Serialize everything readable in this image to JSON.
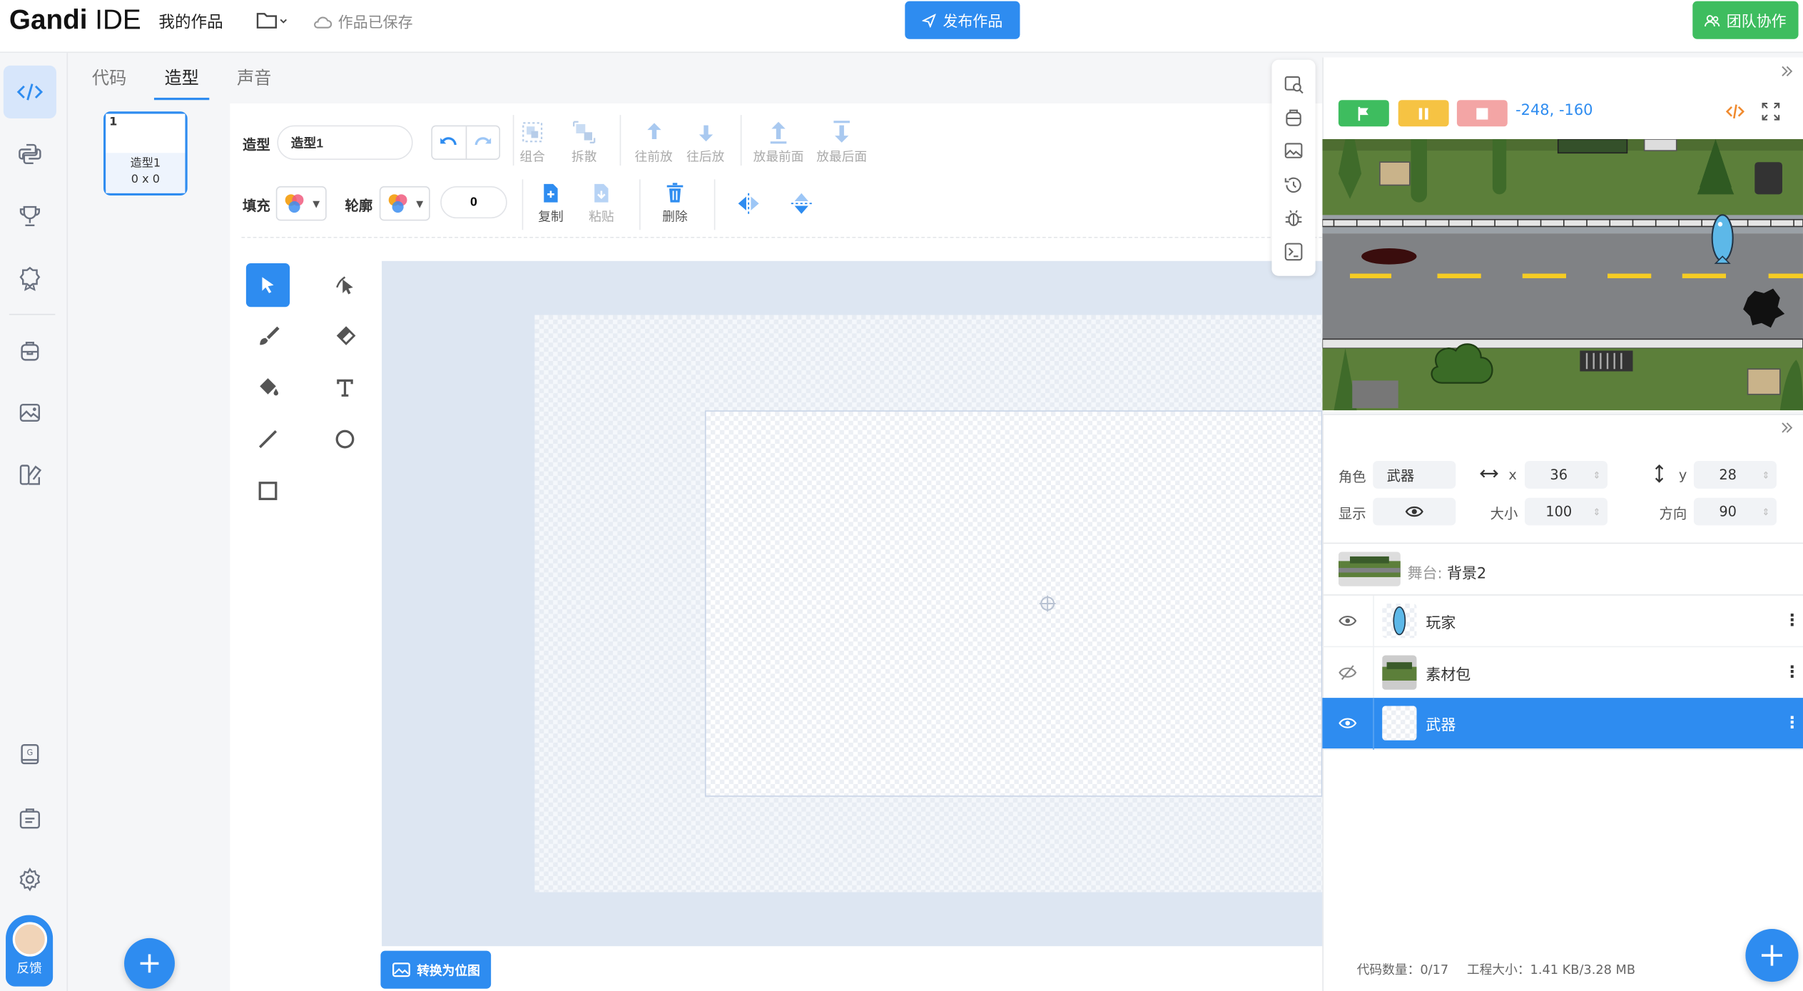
{
  "header": {
    "brand_bold": "Gandi",
    "brand_light": " IDE",
    "my_works": "我的作品",
    "saved_status": "作品已保存",
    "publish_label": "发布作品",
    "team_label": "团队协作"
  },
  "sidebar": {
    "feedback_label": "反馈"
  },
  "tabs": [
    {
      "label": "代码"
    },
    {
      "label": "造型"
    },
    {
      "label": "声音"
    }
  ],
  "costumes": [
    {
      "index": "1",
      "name": "造型1",
      "size": "0 x 0"
    }
  ],
  "paint": {
    "costume_label": "造型",
    "costume_name": "造型1",
    "group": "组合",
    "ungroup": "拆散",
    "forward": "往前放",
    "backward": "往后放",
    "front": "放最前面",
    "back": "放最后面",
    "fill_label": "填充",
    "outline_label": "轮廓",
    "stroke_width": "0",
    "copy": "复制",
    "paste": "粘贴",
    "delete": "删除",
    "convert_label": "转换为位图"
  },
  "stage": {
    "coords": "-248, -160"
  },
  "sprite_info": {
    "sprite_label": "角色",
    "sprite_name": "武器",
    "x_label": "x",
    "x_value": "36",
    "y_label": "y",
    "y_value": "28",
    "show_label": "显示",
    "size_label": "大小",
    "size_value": "100",
    "direction_label": "方向",
    "direction_value": "90"
  },
  "stage_row": {
    "label": "舞台:",
    "name": "背景2"
  },
  "sprites": [
    {
      "name": "玩家",
      "visible": true
    },
    {
      "name": "素材包",
      "visible": false
    },
    {
      "name": "武器",
      "visible": true
    }
  ],
  "footer": {
    "code_count": "代码数量：0/17",
    "project_size": "工程大小：1.41 KB/3.28 MB"
  },
  "colors": {
    "accent": "#2e8cf0",
    "green": "#3ebd5f",
    "pause": "#f6c343",
    "stop": "#f3a5a5"
  }
}
